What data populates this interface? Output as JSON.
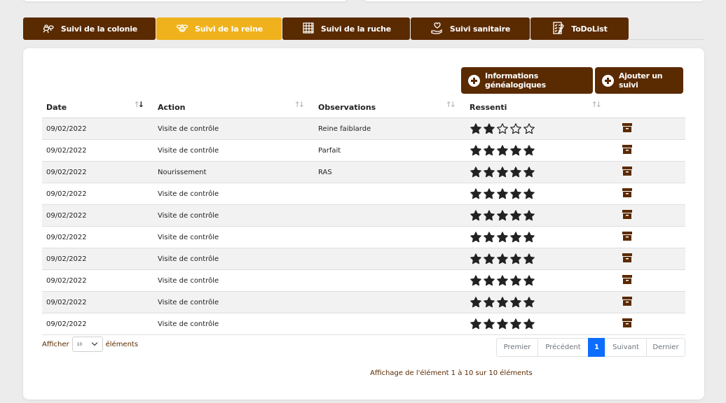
{
  "tabs": [
    {
      "label": "Suivi de la colonie",
      "icon": "bees-icon",
      "active": false
    },
    {
      "label": "Suivi de la reine",
      "icon": "queen-bee-icon",
      "active": true
    },
    {
      "label": "Suivi de la ruche",
      "icon": "hive-frame-icon",
      "active": false
    },
    {
      "label": "Suivi sanitaire",
      "icon": "health-hand-icon",
      "active": false
    },
    {
      "label": "ToDoList",
      "icon": "checklist-icon",
      "active": false
    }
  ],
  "actions": {
    "genealogy_label": "Informations généalogiques",
    "add_label": "Ajouter un suivi"
  },
  "table": {
    "columns": [
      "Date",
      "Action",
      "Observations",
      "Ressenti"
    ],
    "sorted_column": "Date",
    "rows": [
      {
        "date": "09/02/2022",
        "action": "Visite de contrôle",
        "observations": "Reine faiblarde",
        "rating": 2
      },
      {
        "date": "09/02/2022",
        "action": "Visite de contrôle",
        "observations": "Parfait",
        "rating": 5
      },
      {
        "date": "09/02/2022",
        "action": "Nourissement",
        "observations": "RAS",
        "rating": 5
      },
      {
        "date": "09/02/2022",
        "action": "Visite de contrôle",
        "observations": "",
        "rating": 5
      },
      {
        "date": "09/02/2022",
        "action": "Visite de contrôle",
        "observations": "",
        "rating": 5
      },
      {
        "date": "09/02/2022",
        "action": "Visite de contrôle",
        "observations": "",
        "rating": 5
      },
      {
        "date": "09/02/2022",
        "action": "Visite de contrôle",
        "observations": "",
        "rating": 5
      },
      {
        "date": "09/02/2022",
        "action": "Visite de contrôle",
        "observations": "",
        "rating": 5
      },
      {
        "date": "09/02/2022",
        "action": "Visite de contrôle",
        "observations": "",
        "rating": 5
      },
      {
        "date": "09/02/2022",
        "action": "Visite de contrôle",
        "observations": "",
        "rating": 5
      }
    ]
  },
  "length": {
    "prefix": "Afficher",
    "value": "10",
    "suffix": "éléments"
  },
  "pagination": {
    "first": "Premier",
    "prev": "Précédent",
    "current": "1",
    "next": "Suivant",
    "last": "Dernier"
  },
  "info": "Affichage de l'élément 1 à 10 sur 10 éléments",
  "colors": {
    "brown": "#5a2a00",
    "gold": "#f0b21c",
    "page_active": "#0d6efd"
  }
}
